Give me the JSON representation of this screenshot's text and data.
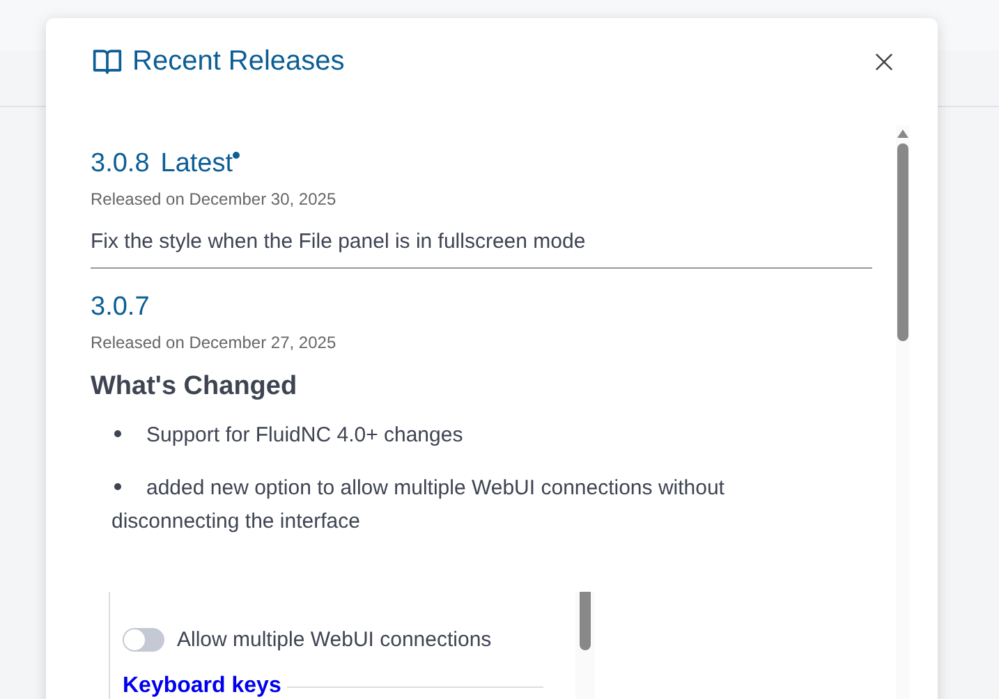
{
  "dialog": {
    "title": "Recent Releases"
  },
  "releases": [
    {
      "version": "3.0.8",
      "badge": "Latest",
      "date": "Released on December 30, 2025",
      "notes": [
        {
          "kind": "paragraph",
          "text": "Fix the style when the File panel is in fullscreen mode"
        }
      ]
    },
    {
      "version": "3.0.7",
      "date": "Released on December 27, 2025",
      "notes": [
        {
          "kind": "heading",
          "text": "What's Changed"
        },
        {
          "kind": "bullet",
          "text": "Support for FluidNC 4.0+ changes"
        },
        {
          "kind": "bullet",
          "text": "added new option to allow multiple WebUI connections without disconnecting the interface"
        },
        {
          "kind": "screenshot",
          "toggle": {
            "label": "Allow multiple WebUI connections",
            "on": false
          },
          "section": "Keyboard keys"
        }
      ]
    }
  ]
}
